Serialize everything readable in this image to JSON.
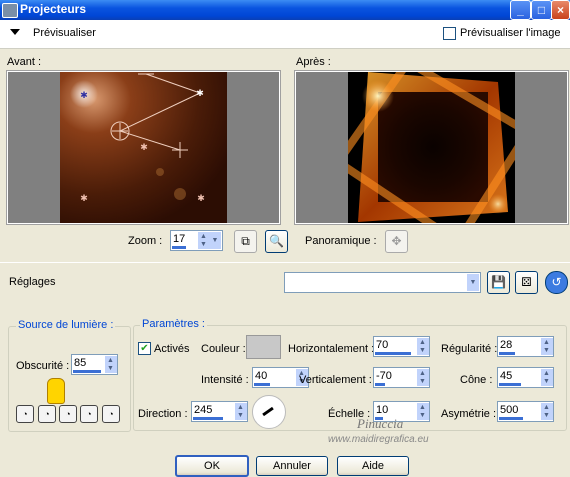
{
  "window": {
    "title": "Projecteurs",
    "min": "_",
    "max": "□",
    "close": "×"
  },
  "preview": {
    "label": "Prévisualiser",
    "checkbox_label": "Prévisualiser l'image"
  },
  "before": {
    "label": "Avant :"
  },
  "after": {
    "label": "Après :"
  },
  "zoom": {
    "label": "Zoom :",
    "value": "17"
  },
  "pan": {
    "label": "Panoramique :"
  },
  "settings": {
    "label": "Réglages",
    "value": ""
  },
  "light_source": {
    "title": "Source de lumière :",
    "darkness_label": "Obscurité :",
    "darkness_value": "85"
  },
  "params": {
    "title": "Paramètres :",
    "active_label": "Activés",
    "color_label": "Couleur :",
    "horizontal_label": "Horizontalement :",
    "horizontal_value": "70",
    "regularity_label": "Régularité :",
    "regularity_value": "28",
    "intensity_label": "Intensité :",
    "intensity_value": "40",
    "vertical_label": "Verticalement :",
    "vertical_value": "-70",
    "cone_label": "Cône :",
    "cone_value": "45",
    "direction_label": "Direction :",
    "direction_value": "245",
    "scale_label": "Échelle :",
    "scale_value": "10",
    "asymmetry_label": "Asymétrie :",
    "asymmetry_value": "500",
    "color_swatch": "#c8c8c8"
  },
  "watermark": {
    "line1": "Pinuccia",
    "line2": "www.maidiregrafica.eu"
  },
  "buttons": {
    "ok": "OK",
    "cancel": "Annuler",
    "help": "Aide"
  }
}
